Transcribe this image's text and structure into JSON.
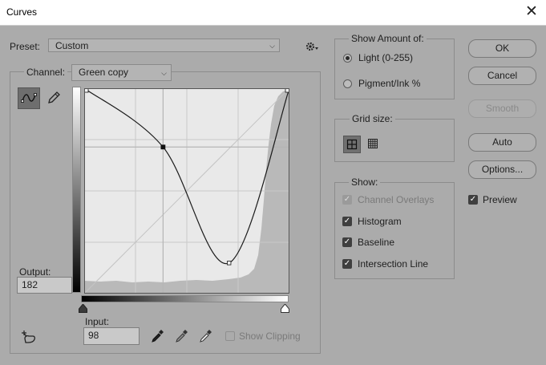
{
  "window": {
    "title": "Curves",
    "close_glyph": "✕"
  },
  "preset": {
    "label": "Preset:",
    "value": "Custom"
  },
  "channel": {
    "label": "Channel:",
    "value": "Green copy"
  },
  "output": {
    "label": "Output:",
    "value": "182"
  },
  "input": {
    "label": "Input:",
    "value": "98"
  },
  "show_clipping": {
    "label": "Show Clipping",
    "checked": false
  },
  "show_amount": {
    "title": "Show Amount of:",
    "options": [
      {
        "label": "Light  (0-255)",
        "selected": true
      },
      {
        "label": "Pigment/Ink %",
        "selected": false
      }
    ]
  },
  "grid_size": {
    "title": "Grid size:",
    "selected": "simple"
  },
  "show": {
    "title": "Show:",
    "items": [
      {
        "label": "Channel Overlays",
        "checked": true,
        "disabled": true
      },
      {
        "label": "Histogram",
        "checked": true,
        "disabled": false
      },
      {
        "label": "Baseline",
        "checked": true,
        "disabled": false
      },
      {
        "label": "Intersection Line",
        "checked": true,
        "disabled": false
      }
    ]
  },
  "buttons": {
    "ok": "OK",
    "cancel": "Cancel",
    "smooth": "Smooth",
    "auto": "Auto",
    "options": "Options..."
  },
  "preview": {
    "label": "Preview",
    "checked": true
  },
  "curve": {
    "points": [
      [
        0,
        255
      ],
      [
        98,
        182
      ],
      [
        180,
        38
      ],
      [
        255,
        255
      ]
    ],
    "selected_point": 1
  },
  "colors": {
    "dialog_bg": "#ababab",
    "graph_bg": "#e9e9e9",
    "histogram": "#b9b9b9",
    "curve": "#1a1a1a"
  },
  "icons": {
    "preset_gear": "gear-icon",
    "curve_tool": "curve-points-icon",
    "pencil_tool": "pencil-icon",
    "target_adjust": "hand-target-icon",
    "eyedroppers": [
      "black-eyedropper-icon",
      "gray-eyedropper-icon",
      "white-eyedropper-icon"
    ]
  }
}
